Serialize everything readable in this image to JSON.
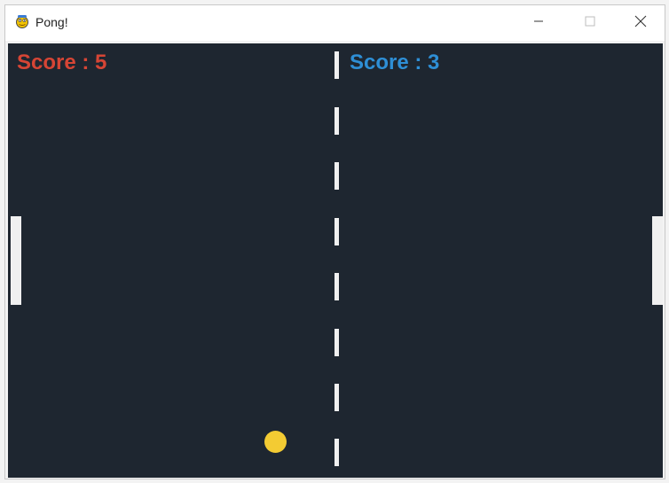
{
  "window": {
    "title": "Pong!",
    "icon": "pygame-snake-icon"
  },
  "controls": {
    "minimize_icon": "minimize-icon",
    "maximize_icon": "maximize-icon",
    "close_icon": "close-icon"
  },
  "game": {
    "background_color": "#1e2630",
    "left_score": {
      "text": "Score : 5",
      "value": 5,
      "color": "#d64535"
    },
    "right_score": {
      "text": "Score : 3",
      "value": 3,
      "color": "#2e8fd6"
    },
    "ball_color": "#f3cb33",
    "paddle_color": "#f0f0f0"
  }
}
